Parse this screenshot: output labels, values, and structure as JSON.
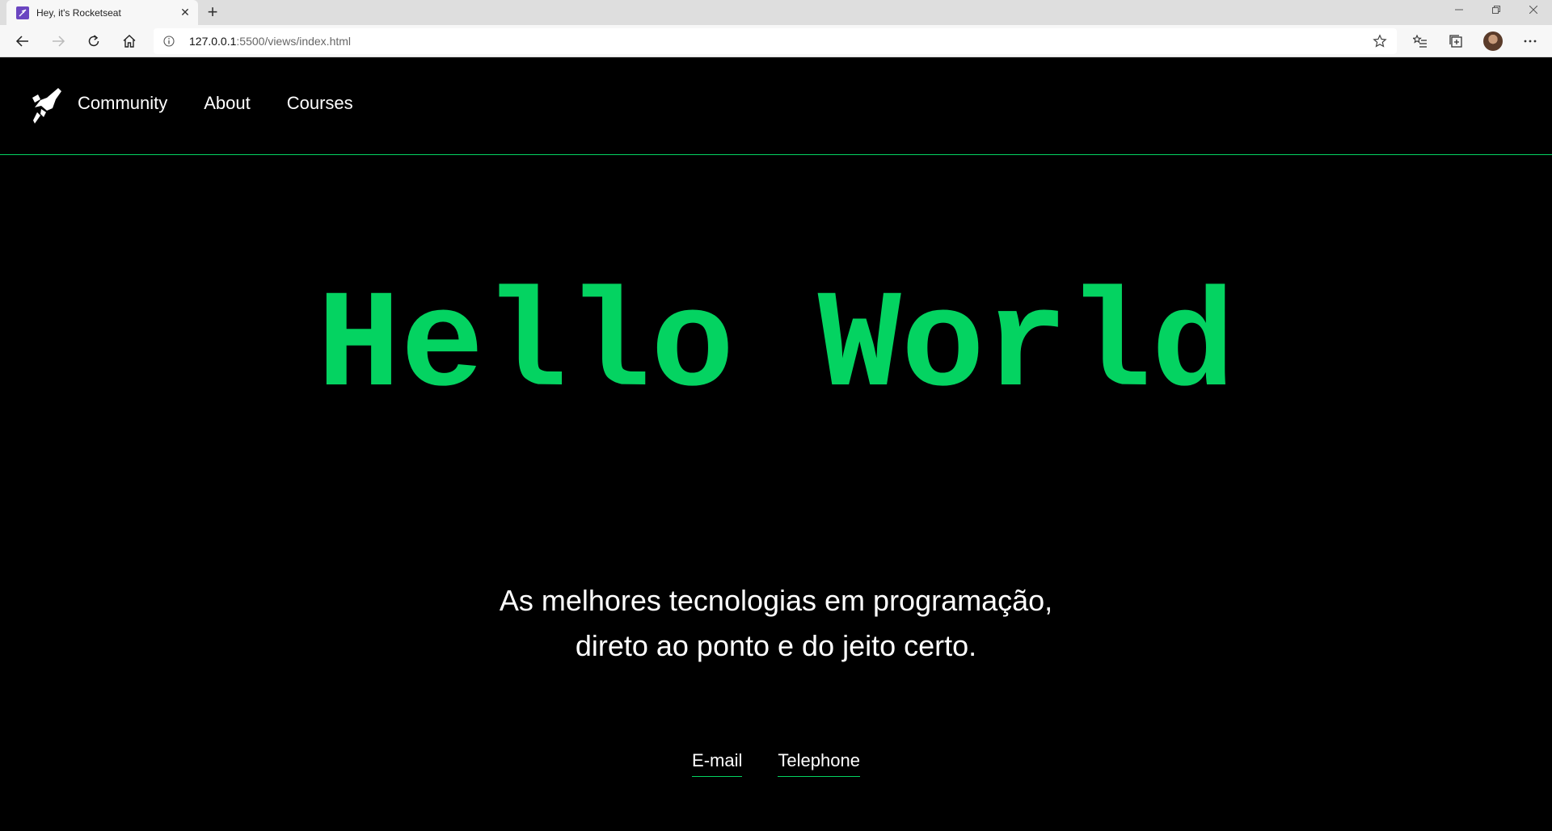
{
  "browser": {
    "tab_title": "Hey, it's Rocketseat",
    "url_host": "127.0.0.1",
    "url_rest": ":5500/views/index.html"
  },
  "site": {
    "nav": [
      "Community",
      "About",
      "Courses"
    ],
    "hero_title": "Hello World",
    "tagline_line1": "As melhores tecnologias em programação,",
    "tagline_line2": "direto ao ponto e do jeito certo.",
    "contacts": [
      "E-mail",
      "Telephone"
    ]
  },
  "colors": {
    "accent": "#04d361",
    "background": "#000000",
    "text": "#ffffff"
  }
}
